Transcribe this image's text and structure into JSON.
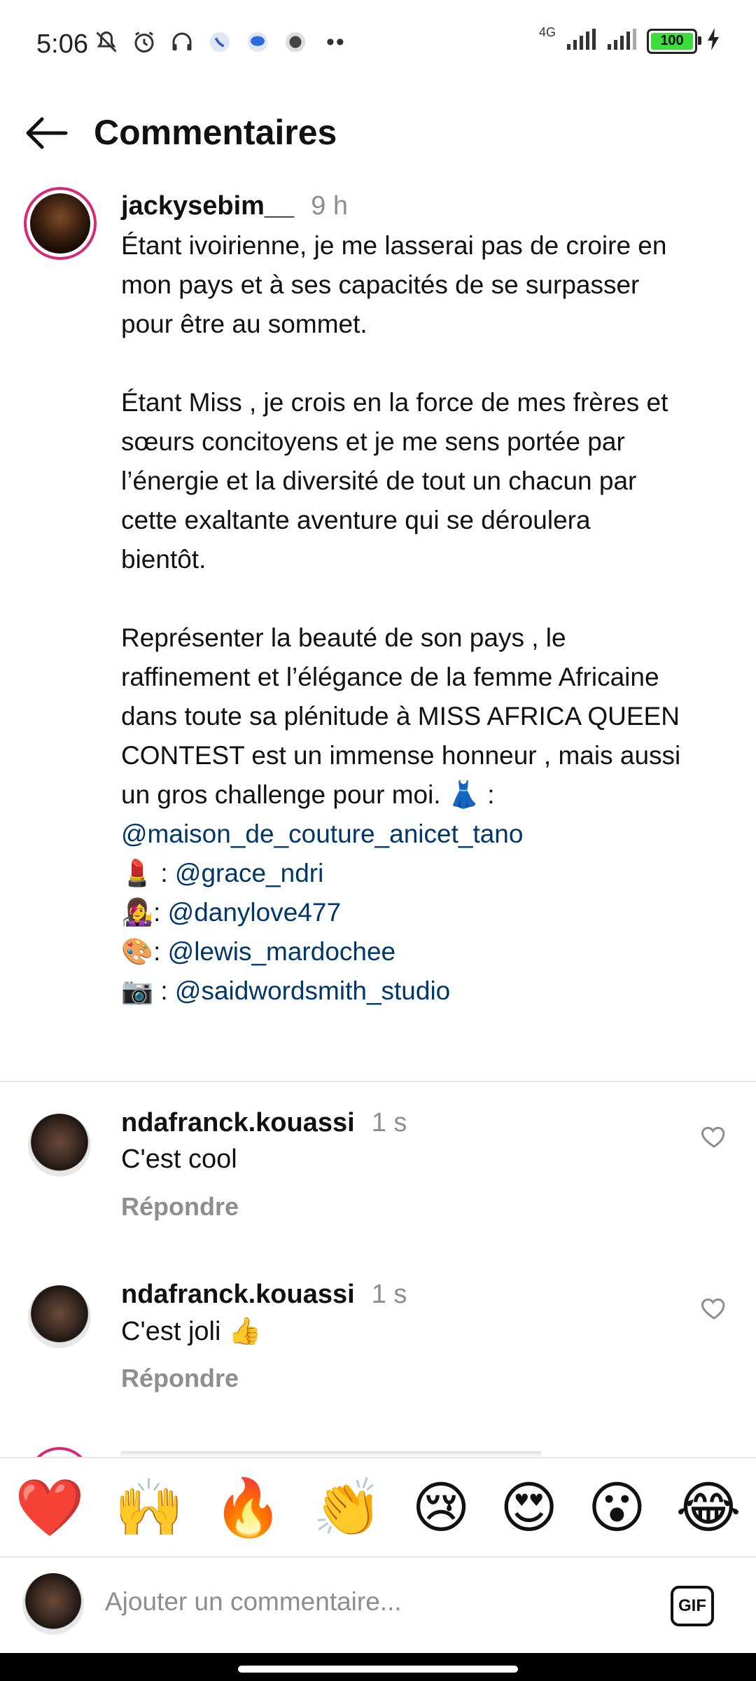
{
  "status_bar": {
    "time": "5:06",
    "network": "4G",
    "battery": "100",
    "icons": [
      "mute-icon",
      "alarm-icon",
      "headphones-icon",
      "app-icon",
      "chat-icon",
      "app-icon",
      "more-dots"
    ]
  },
  "header": {
    "title": "Commentaires"
  },
  "caption": {
    "username": "jackysebim__",
    "time": "9 h",
    "para1": "Étant ivoirienne, je me lasserai pas de croire en mon pays et à ses capacités de se surpasser pour être au sommet.",
    "para2": "Étant Miss , je crois en la force de mes frères et sœurs concitoyens et je me sens portée par l’énergie et la diversité de tout un chacun par cette exaltante aventure qui se déroulera bientôt.",
    "para3": "Représenter la beauté de son pays , le raffinement et l’élégance de la femme Africaine dans toute sa plénitude à MISS AFRICA QUEEN CONTEST est un immense honneur , mais aussi un gros challenge pour moi. 👗 :",
    "credits": [
      {
        "prefix": "",
        "mention": "@maison_de_couture_anicet_tano"
      },
      {
        "prefix": "💄 : ",
        "mention": "@grace_ndri"
      },
      {
        "prefix": "👩‍🎤: ",
        "mention": "@danylove477"
      },
      {
        "prefix": "🎨: ",
        "mention": "@lewis_mardochee"
      },
      {
        "prefix": "📷 : ",
        "mention": "@saidwordsmith_studio"
      }
    ]
  },
  "comments": [
    {
      "username": "ndafranck.kouassi",
      "time": "1 s",
      "text": "C'est cool",
      "reply": "Répondre"
    },
    {
      "username": "ndafranck.kouassi",
      "time": "1 s",
      "text": "C'est joli 👍",
      "reply": "Répondre"
    }
  ],
  "emoji_bar": [
    "❤️",
    "🙌",
    "🔥",
    "👏",
    "😢",
    "😍",
    "😮",
    "😂"
  ],
  "input": {
    "placeholder": "Ajouter un commentaire...",
    "gif_label": "GIF"
  },
  "colors": {
    "mention": "#00376b",
    "secondary_text": "#8e8e8e",
    "story_ring": "#d62976",
    "battery_fill": "#3ddc3d"
  }
}
